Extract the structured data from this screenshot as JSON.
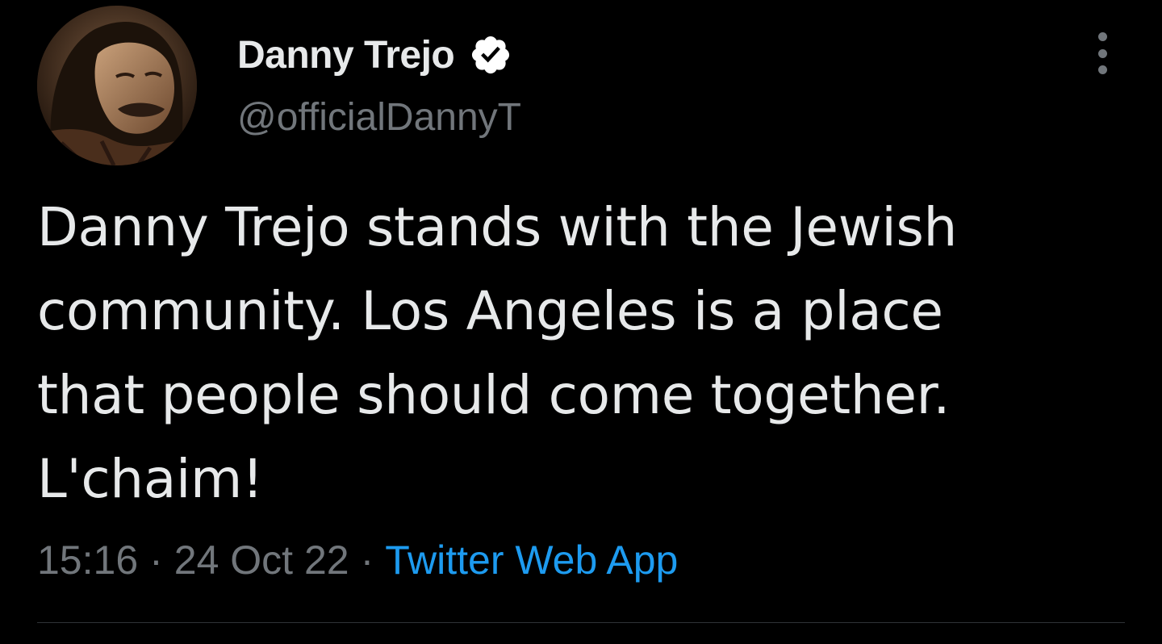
{
  "tweet": {
    "author": {
      "display_name": "Danny Trejo",
      "handle": "@officialDannyT",
      "verified": true,
      "avatar_icon": "profile-photo"
    },
    "text": "Danny Trejo stands with the Jewish\ncommunity. Los Angeles is a place\nthat people should come together.\nL'chaim!",
    "time": "15:16",
    "separator": "·",
    "date": "24 Oct 22",
    "source": "Twitter Web App",
    "more_icon": "more-options-icon"
  },
  "colors": {
    "background": "#000000",
    "primary_text": "#e7e9ea",
    "secondary_text": "#71767b",
    "link": "#1d9bf0",
    "divider": "#2f3336",
    "verified_badge": "#ffffff"
  }
}
